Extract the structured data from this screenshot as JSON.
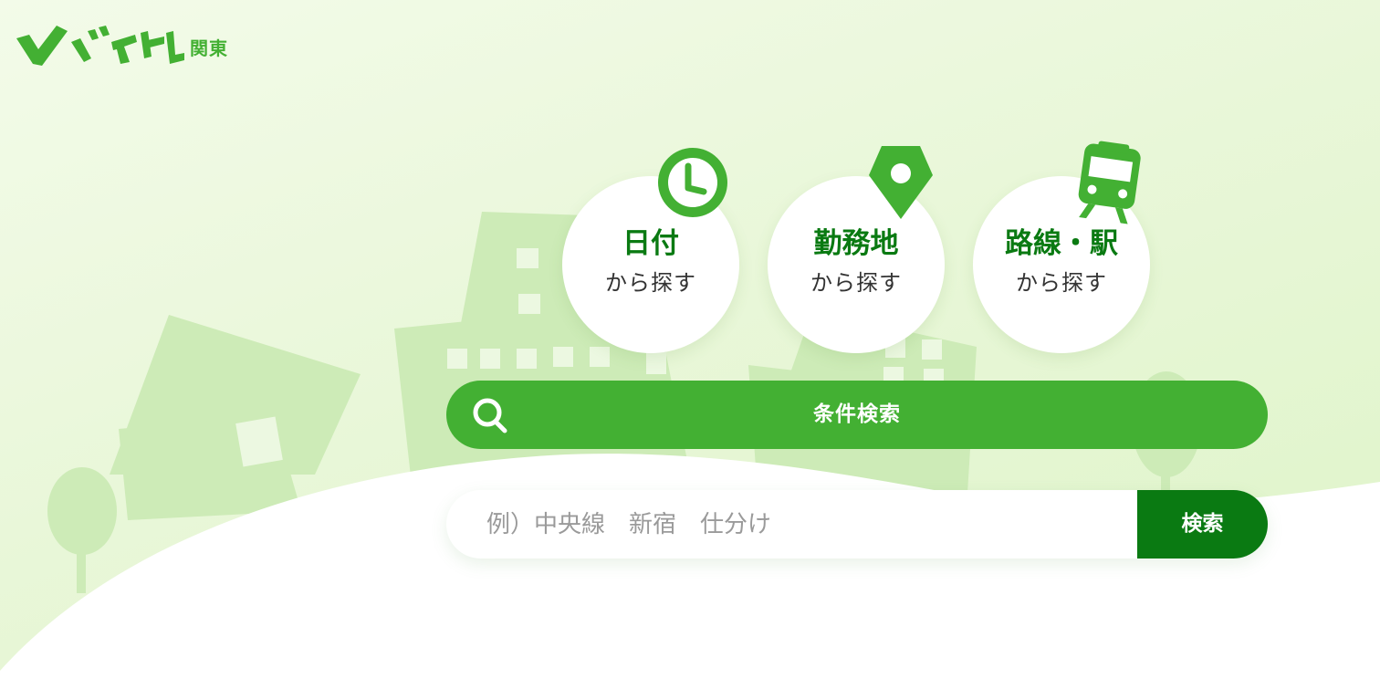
{
  "header": {
    "logo_alt": "バイトル",
    "region": "関東"
  },
  "categories": [
    {
      "main": "日付",
      "sub": "から探す",
      "icon": "clock-icon"
    },
    {
      "main": "勤務地",
      "sub": "から探す",
      "icon": "map-pin-icon"
    },
    {
      "main": "路線・駅",
      "sub": "から探す",
      "icon": "train-icon"
    }
  ],
  "condition_search": {
    "label": "条件検索",
    "icon": "search-icon"
  },
  "keyword_search": {
    "placeholder": "例）中央線　新宿　仕分け",
    "value": "",
    "button_label": "検索"
  },
  "colors": {
    "brand_green": "#43b033",
    "dark_green": "#0a7a12",
    "background": "#e9f7d9"
  }
}
